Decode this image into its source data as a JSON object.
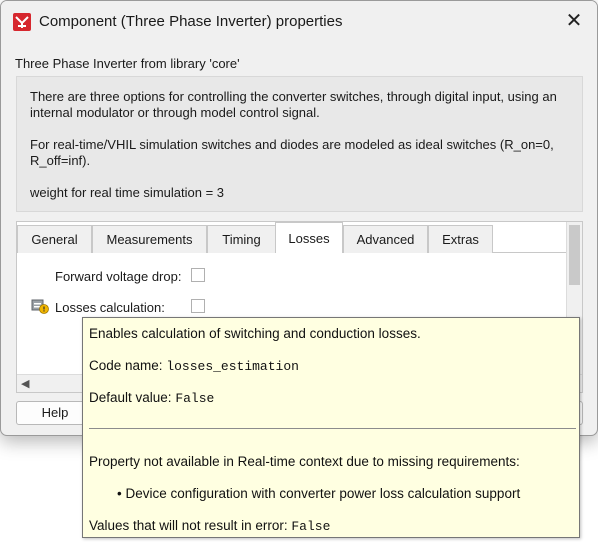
{
  "window": {
    "title": "Component (Three Phase Inverter) properties",
    "close_glyph": "✕"
  },
  "subtitle": "Three Phase Inverter from library 'core'",
  "description": {
    "para1": "There are three options for controlling the converter switches, through digital input, using an internal modulator or through model control signal.",
    "para2": "For real-time/VHIL simulation switches and diodes are modeled as ideal switches (R_on=0, R_off=inf).",
    "para3": "weight for real time simulation = 3"
  },
  "tabs": [
    {
      "label": "General",
      "active": false
    },
    {
      "label": "Measurements",
      "active": false
    },
    {
      "label": "Timing",
      "active": false
    },
    {
      "label": "Losses",
      "active": true
    },
    {
      "label": "Advanced",
      "active": false
    },
    {
      "label": "Extras",
      "active": false
    }
  ],
  "properties": {
    "forward_voltage_drop": {
      "label": "Forward voltage drop:",
      "checked": false
    },
    "losses_calculation": {
      "label": "Losses calculation:",
      "checked": false,
      "icon": "warning-lock-icon"
    }
  },
  "buttons": {
    "help": "Help"
  },
  "tooltip": {
    "line1": "Enables calculation of switching and conduction losses.",
    "code_name_label": "Code name:",
    "code_name_value": "losses_estimation",
    "default_label": "Default value:",
    "default_value": "False",
    "unavailable": "Property not available in Real-time context due to missing requirements:",
    "bullet": "•",
    "requirement": "Device configuration with converter power loss calculation support",
    "no_error_label": "Values that will not result in error:",
    "no_error_value": "False"
  },
  "colors": {
    "tooltip_bg": "#ffffe1",
    "dialog_bg": "#f0f0f0",
    "app_icon": "#d6272e"
  }
}
